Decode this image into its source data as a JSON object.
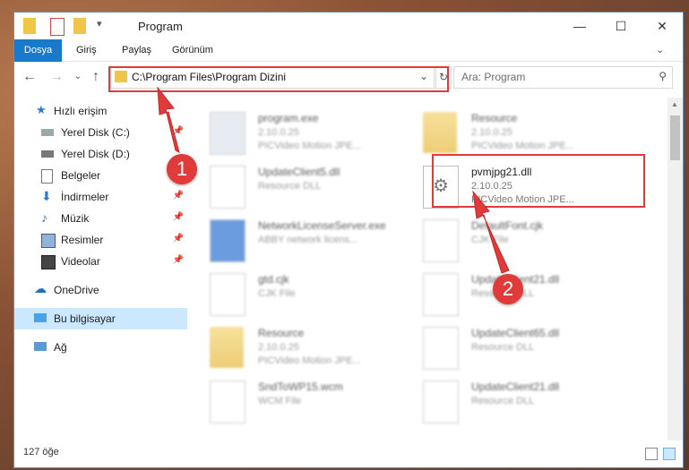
{
  "window": {
    "title": "Program"
  },
  "ribbon": {
    "tabs": [
      "Dosya",
      "Giriş",
      "Paylaş",
      "Görünüm"
    ]
  },
  "nav": {
    "address": "C:\\Program Files\\Program Dizini",
    "search_placeholder": "Ara: Program"
  },
  "sidebar": {
    "items": [
      {
        "label": "Hızlı erişim",
        "icon": "star-icon"
      },
      {
        "label": "Yerel Disk (C:)",
        "icon": "drive-icon"
      },
      {
        "label": "Yerel Disk (D:)",
        "icon": "drive-icon"
      },
      {
        "label": "Belgeler",
        "icon": "documents-icon"
      },
      {
        "label": "İndirmeler",
        "icon": "download-icon"
      },
      {
        "label": "Müzik",
        "icon": "music-icon"
      },
      {
        "label": "Resimler",
        "icon": "pictures-icon"
      },
      {
        "label": "Videolar",
        "icon": "videos-icon"
      },
      {
        "label": "OneDrive",
        "icon": "cloud-icon"
      },
      {
        "label": "Bu bilgisayar",
        "icon": "computer-icon"
      },
      {
        "label": "Ağ",
        "icon": "network-icon"
      }
    ]
  },
  "files": [
    {
      "name": "program.exe",
      "l1": "2.10.0.25",
      "l2": "PICVideo Motion JPE...",
      "kind": "exe"
    },
    {
      "name": "Resource",
      "l1": "2.10.0.25",
      "l2": "PICVideo Motion JPE...",
      "kind": "folder"
    },
    {
      "name": "UpdateClient5.dll",
      "l1": "Resource DLL",
      "l2": "",
      "kind": "dll"
    },
    {
      "name": "pvmjpg21.dll",
      "l1": "2.10.0.25",
      "l2": "PICVideo Motion JPE...",
      "kind": "dll"
    },
    {
      "name": "NetworkLicenseServer.exe",
      "l1": "ABBY network licens...",
      "l2": "",
      "kind": "exe"
    },
    {
      "name": "DefaultFont.cjk",
      "l1": "CJK File",
      "l2": "",
      "kind": "doc"
    },
    {
      "name": "gtd.cjk",
      "l1": "CJK File",
      "l2": "",
      "kind": "doc"
    },
    {
      "name": "UpdateClient21.dll",
      "l1": "Resource DLL",
      "l2": "",
      "kind": "doc"
    },
    {
      "name": "Resource",
      "l1": "2.10.0.25",
      "l2": "PICVideo Motion JPE...",
      "kind": "folder"
    },
    {
      "name": "UpdateClient65.dll",
      "l1": "Resource DLL",
      "l2": "",
      "kind": "doc"
    },
    {
      "name": "SndToWP15.wcm",
      "l1": "WCM File",
      "l2": "",
      "kind": "doc"
    },
    {
      "name": "UpdateClient21.dll",
      "l1": "Resource DLL",
      "l2": "",
      "kind": "doc"
    }
  ],
  "status": {
    "count": "127 öğe"
  },
  "annotations": {
    "step1": "1",
    "step2": "2"
  },
  "colors": {
    "accent": "#1979ca",
    "highlight": "#e03a3a",
    "selected": "#cce8ff"
  }
}
